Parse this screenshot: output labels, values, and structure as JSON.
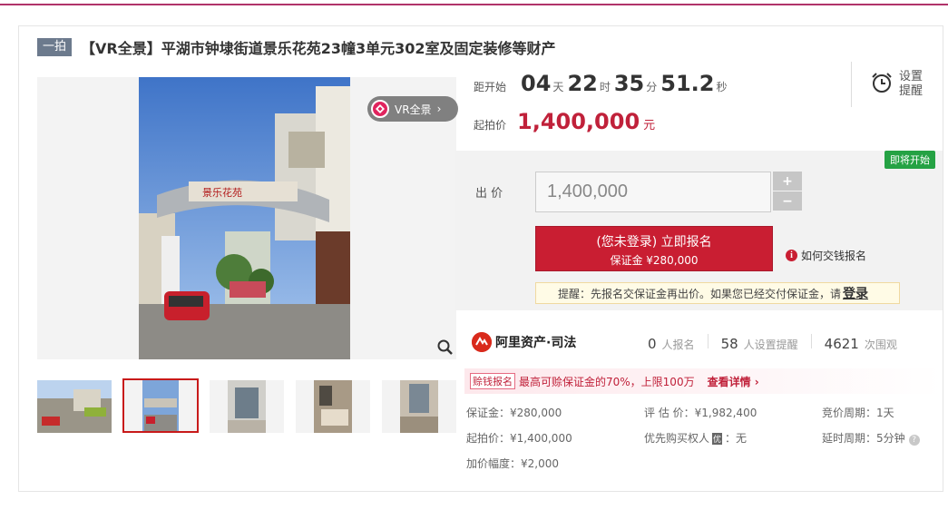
{
  "round": "一拍",
  "title": "【VR全景】平湖市钟埭街道景乐花苑23幢3单元302室及固定装修等财产",
  "vr_label": "VR全景",
  "countdown": {
    "label": "距开始",
    "days": "04",
    "days_unit": "天",
    "hours": "22",
    "hours_unit": "时",
    "minutes": "35",
    "minutes_unit": "分",
    "seconds": "51.2",
    "seconds_unit": "秒"
  },
  "remind": {
    "line1": "设置",
    "line2": "提醒"
  },
  "start_price": {
    "label": "起拍价",
    "value": "1,400,000",
    "unit": "元"
  },
  "status_badge": "即将开始",
  "bid": {
    "label": "出 价",
    "value": "1,400,000",
    "plus": "+",
    "minus": "−"
  },
  "signup": {
    "line1": "(您未登录) 立即报名",
    "line2": "保证金 ¥280,000"
  },
  "how_pay": "如何交钱报名",
  "tip": {
    "text": "提醒：先报名交保证金再出价。如果您已经交付保证金，请",
    "link": "登录"
  },
  "platform": "阿里资产·司法",
  "stats": [
    {
      "num": "0",
      "label": "人报名"
    },
    {
      "num": "58",
      "label": "人设置提醒"
    },
    {
      "num": "4621",
      "label": "次围观"
    }
  ],
  "promo": {
    "tag": "赊钱报名",
    "text": "最高可赊保证金的70%，上限100万",
    "link": "查看详情 ›"
  },
  "info": {
    "deposit": "保证金：¥280,000",
    "start": "起拍价：¥1,400,000",
    "increment": "加价幅度：¥2,000",
    "appraisal": "评 估 价：¥1,982,400",
    "priority_label": "优先购买权人",
    "priority_flag": "优",
    "priority_value": "：无",
    "period": "竞价周期：1天",
    "delay": "延时周期：5分钟"
  },
  "photo_sign": "景乐花苑"
}
